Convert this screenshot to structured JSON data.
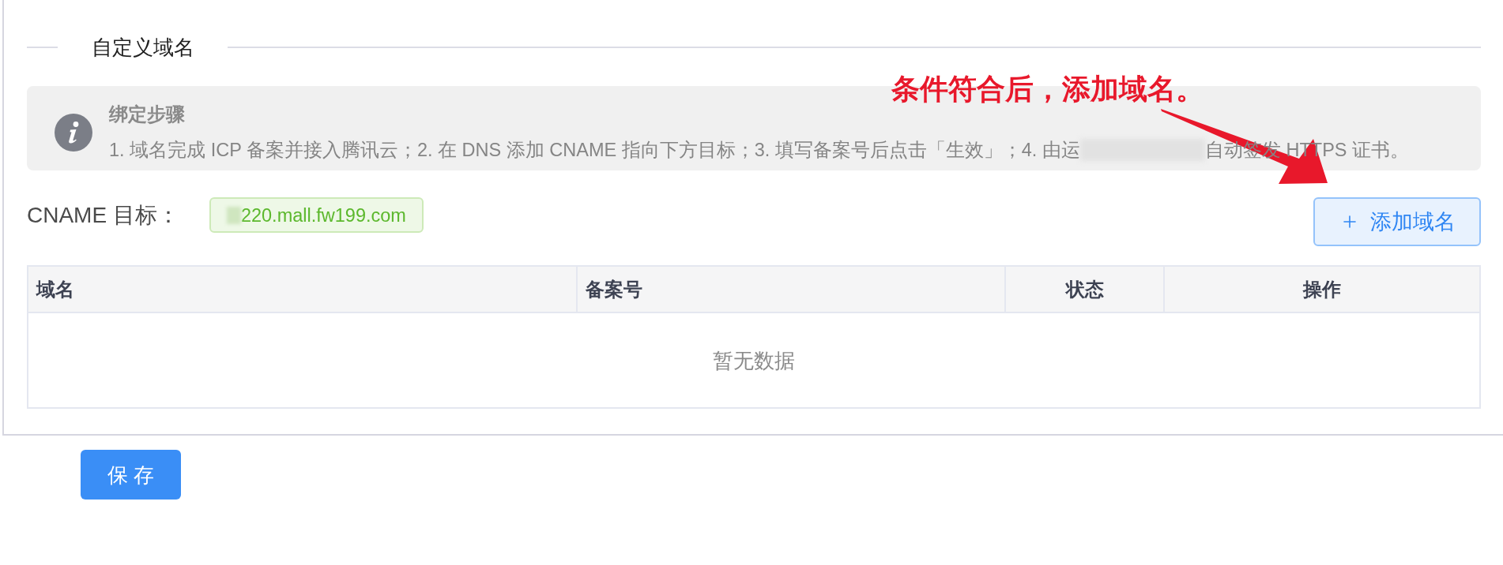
{
  "section": {
    "title": "自定义域名"
  },
  "notice": {
    "title": "绑定步骤",
    "text_parts": [
      "1. 域名完成 ICP 备案并接入腾讯云；2. 在 DNS 添加 CNAME 指向下方目标；3. 填写备案号后点击「生效」；4. 由运",
      "自动签发 HTTPS 证书。"
    ]
  },
  "annotation": {
    "text": "条件符合后，添加域名。"
  },
  "cname": {
    "label": "CNAME 目标：",
    "value": "220.mall.fw199.com"
  },
  "add_button": {
    "label": "添加域名"
  },
  "table": {
    "columns": [
      "域名",
      "备案号",
      "状态",
      "操作"
    ],
    "empty_text": "暂无数据"
  },
  "save_button": {
    "label": "保 存"
  }
}
